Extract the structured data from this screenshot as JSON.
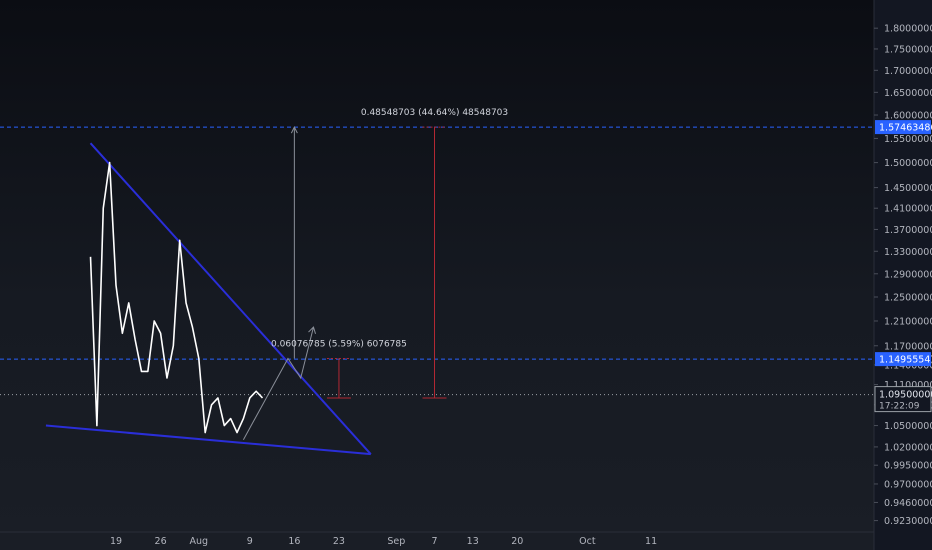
{
  "chart_data": {
    "type": "line",
    "x_unit": "days from Jul 19",
    "ylim": [
      0.915,
      1.83
    ],
    "y_ticks": [
      "0.923000000",
      "0.946000000",
      "0.970000000",
      "0.995000000",
      "1.020000000",
      "1.050000000",
      "1.080000000",
      "1.110000000",
      "1.140000000",
      "1.170000000",
      "1.210000000",
      "1.250000000",
      "1.290000000",
      "1.330000000",
      "1.370000000",
      "1.410000000",
      "1.450000000",
      "1.500000000",
      "1.550000000",
      "1.600000000",
      "1.650000000",
      "1.700000000",
      "1.750000000",
      "1.800000000"
    ],
    "x_ticks": [
      {
        "label": "19",
        "day": 0
      },
      {
        "label": "26",
        "day": 7
      },
      {
        "label": "Aug",
        "day": 13
      },
      {
        "label": "9",
        "day": 21
      },
      {
        "label": "16",
        "day": 28
      },
      {
        "label": "23",
        "day": 35
      },
      {
        "label": "Sep",
        "day": 44
      },
      {
        "label": "7",
        "day": 50
      },
      {
        "label": "13",
        "day": 56
      },
      {
        "label": "20",
        "day": 63
      },
      {
        "label": "Oct",
        "day": 74
      },
      {
        "label": "11",
        "day": 84
      }
    ],
    "series": [
      {
        "name": "price",
        "color": "#ffffff",
        "x": [
          -4,
          -3,
          -2,
          -1,
          0,
          1,
          2,
          3,
          4,
          5,
          6,
          7,
          8,
          9,
          10,
          11,
          12,
          13,
          14,
          15,
          16,
          17,
          18,
          19,
          20,
          21,
          22,
          23
        ],
        "y": [
          1.32,
          1.05,
          1.41,
          1.5,
          1.27,
          1.19,
          1.24,
          1.18,
          1.13,
          1.13,
          1.21,
          1.19,
          1.12,
          1.17,
          1.35,
          1.24,
          1.2,
          1.15,
          1.04,
          1.08,
          1.09,
          1.05,
          1.06,
          1.04,
          1.06,
          1.09,
          1.1,
          1.09
        ]
      }
    ],
    "trendlines": [
      {
        "name": "upper-trendline",
        "color": "#2a2ed8",
        "x": [
          -4,
          40
        ],
        "y": [
          1.54,
          1.01
        ]
      },
      {
        "name": "lower-trendline",
        "color": "#2a2ed8",
        "x": [
          -11,
          40
        ],
        "y": [
          1.05,
          1.01
        ]
      }
    ],
    "projections": [
      {
        "name": "projection-path",
        "color": "#8a8f99",
        "x": [
          20,
          27,
          29,
          31
        ],
        "y": [
          1.03,
          1.15,
          1.12,
          1.2
        ]
      }
    ],
    "measures": [
      {
        "name": "measure-small",
        "label": "0.06076785 (5.59%) 6076785",
        "x": 35,
        "y0": 1.09,
        "y1": 1.15
      },
      {
        "name": "measure-large",
        "label": "0.48548703 (44.64%) 48548703",
        "x": 50,
        "y0": 1.09,
        "y1": 1.574
      }
    ],
    "price_levels": [
      {
        "name": "level-target",
        "label": "1.57463486",
        "value": 1.574,
        "style": "dashed",
        "color": "#2962ff"
      },
      {
        "name": "level-breakout",
        "label": "1.14955547",
        "value": 1.149,
        "style": "dashed",
        "color": "#2962ff"
      },
      {
        "name": "level-current",
        "label": "1.095000000",
        "sublabel": "17:22:09",
        "value": 1.095,
        "style": "dotted",
        "color": "#9aa0a6"
      }
    ]
  }
}
